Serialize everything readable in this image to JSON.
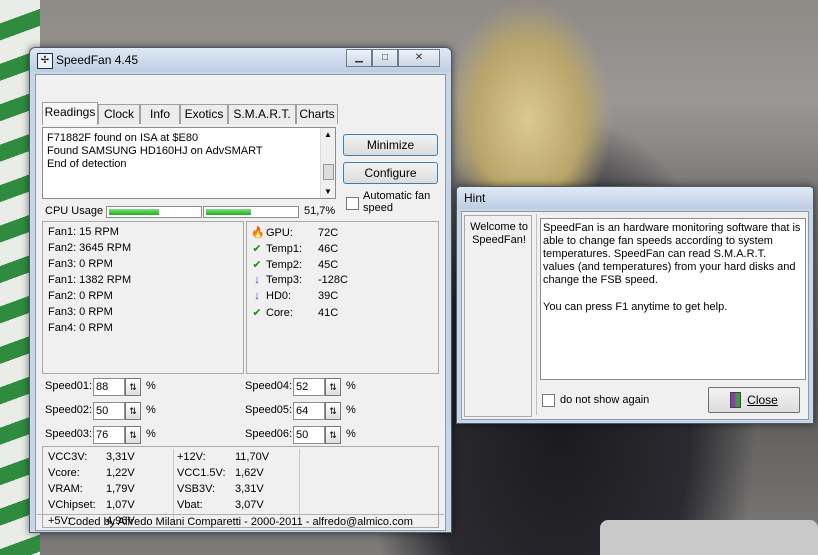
{
  "speedfan": {
    "title": "SpeedFan 4.45",
    "titlebar_buttons": {
      "minimize": "▁",
      "maximize": "□",
      "close": "✕"
    },
    "tabs": [
      "Readings",
      "Clock",
      "Info",
      "Exotics",
      "S.M.A.R.T.",
      "Charts"
    ],
    "log_lines": [
      "F71882F found on ISA at $E80",
      "Found SAMSUNG HD160HJ on AdvSMART",
      "End of detection"
    ],
    "buttons": {
      "minimize": "Minimize",
      "configure": "Configure"
    },
    "auto_fan_label": "Automatic fan speed",
    "cpu_usage": {
      "label": "CPU Usage",
      "value": "51,7%",
      "core1": 0.55,
      "core2": 0.5
    },
    "fans": [
      "Fan1: 15 RPM",
      "Fan2: 3645 RPM",
      "Fan3: 0 RPM",
      "Fan1: 1382 RPM",
      "Fan2: 0 RPM",
      "Fan3: 0 RPM",
      "Fan4: 0 RPM"
    ],
    "temps": [
      {
        "icon": "flame-icon",
        "name": "GPU:",
        "value": "72C"
      },
      {
        "icon": "checkmark-icon",
        "name": "Temp1:",
        "value": "46C"
      },
      {
        "icon": "checkmark-icon",
        "name": "Temp2:",
        "value": "45C"
      },
      {
        "icon": "down-arrow-icon",
        "name": "Temp3:",
        "value": "-128C"
      },
      {
        "icon": "down-arrow-icon",
        "name": "HD0:",
        "value": "39C"
      },
      {
        "icon": "checkmark-icon",
        "name": "Core:",
        "value": "41C"
      }
    ],
    "speeds_left": [
      {
        "label": "Speed01:",
        "value": "88",
        "unit": "%"
      },
      {
        "label": "Speed02:",
        "value": "50",
        "unit": "%"
      },
      {
        "label": "Speed03:",
        "value": "76",
        "unit": "%"
      }
    ],
    "speeds_right": [
      {
        "label": "Speed04:",
        "value": "52",
        "unit": "%"
      },
      {
        "label": "Speed05:",
        "value": "64",
        "unit": "%"
      },
      {
        "label": "Speed06:",
        "value": "50",
        "unit": "%"
      }
    ],
    "voltages_left": [
      {
        "name": "VCC3V:",
        "value": "3,31V"
      },
      {
        "name": "Vcore:",
        "value": "1,22V"
      },
      {
        "name": "VRAM:",
        "value": "1,79V"
      },
      {
        "name": "VChipset:",
        "value": "1,07V"
      },
      {
        "name": "+5V:",
        "value": "4,96V"
      }
    ],
    "voltages_right": [
      {
        "name": "+12V:",
        "value": "11,70V"
      },
      {
        "name": "VCC1.5V:",
        "value": "1,62V"
      },
      {
        "name": "VSB3V:",
        "value": "3,31V"
      },
      {
        "name": "Vbat:",
        "value": "3,07V"
      }
    ],
    "footer": "Coded by Alfredo Milani Comparetti - 2000-2011 - alfredo@almico.com"
  },
  "hint": {
    "title": "Hint",
    "welcome": "Welcome to SpeedFan!",
    "paragraph1": "SpeedFan is an hardware monitoring software that is able to change fan speeds according to system temperatures. SpeedFan can read S.M.A.R.T. values (and temperatures) from your hard disks and change the FSB speed.",
    "paragraph2": "You can press F1 anytime to get help.",
    "do_not_show": "do not show again",
    "close": "Close"
  },
  "icon_glyphs": {
    "flame-icon": "🔥",
    "checkmark-icon": "✔",
    "down-arrow-icon": "↓"
  }
}
